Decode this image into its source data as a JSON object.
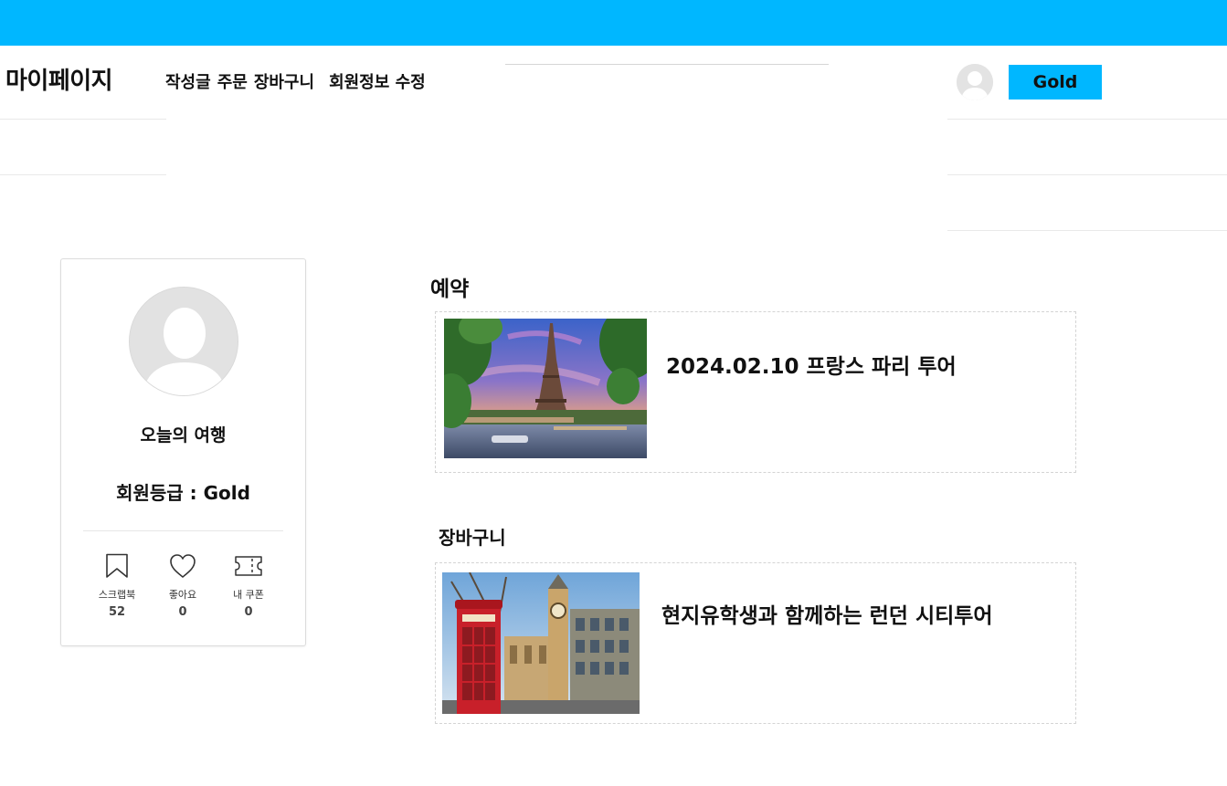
{
  "nav": {
    "title": "마이페이지",
    "links": [
      "작성글",
      "주문",
      "장바구니",
      "회원정보 수정"
    ],
    "grade_button": "Gold"
  },
  "profile": {
    "name": "오늘의 여행",
    "grade": "회원등급 : Gold",
    "stats": [
      {
        "label": "스크랩북",
        "value": "52",
        "icon": "bookmark-icon"
      },
      {
        "label": "좋아요",
        "value": "0",
        "icon": "heart-icon"
      },
      {
        "label": "내 쿠폰",
        "value": "0",
        "icon": "coupon-icon"
      }
    ]
  },
  "reservation": {
    "heading": "예약",
    "item_title": "2024.02.10 프랑스 파리 투어"
  },
  "cart": {
    "heading": "장바구니",
    "item_title": "현지유학생과 함께하는 런던 시티투어"
  },
  "colors": {
    "accent": "#00b7ff",
    "border": "#dcdcdc"
  }
}
